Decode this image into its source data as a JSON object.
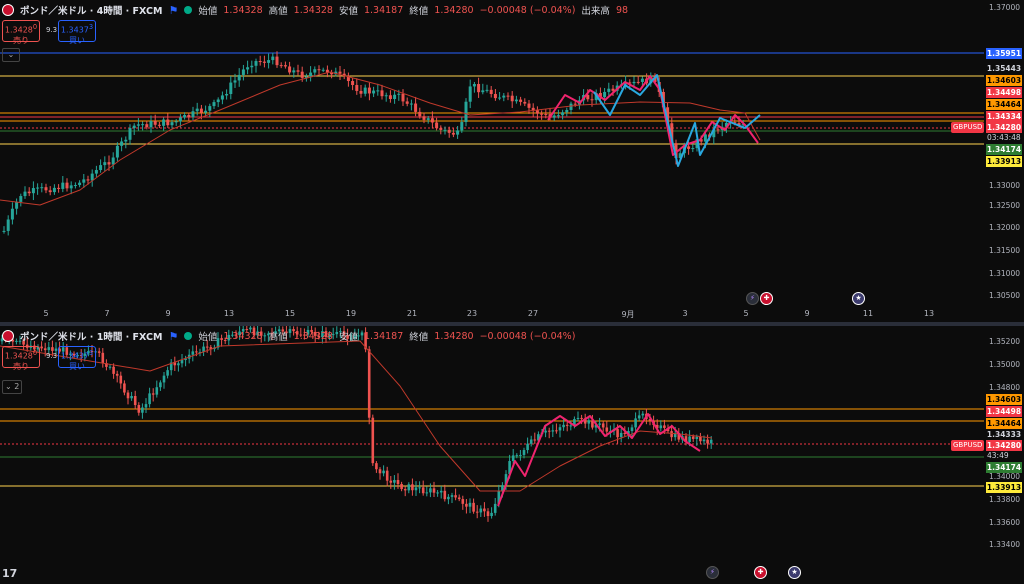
{
  "colors": {
    "up": "#26a69a",
    "down": "#ef5350",
    "ma": "#c0392b",
    "zigzag_pink": "#f0246e",
    "zigzag_blue": "#29a8e0",
    "blue_line": "#2962ff",
    "yellow_line": "#ffd54f",
    "orange_line": "#ff9800",
    "red_line": "#f23645",
    "green_line": "#2e7d32"
  },
  "pane1": {
    "legend": {
      "symbol": "ポンド／米ドル · 4時間 · FXCM",
      "open_label": "始値",
      "open": "1.34328",
      "high_label": "高値",
      "high": "1.34328",
      "low_label": "安値",
      "low": "1.34187",
      "close_label": "終値",
      "close": "1.34280",
      "change": "−0.00048 (−0.04%)",
      "volume_label": "出来高",
      "volume": "98"
    },
    "sell": {
      "price": "1.3428",
      "sup": "0",
      "label": "売り"
    },
    "spread": "9.3",
    "buy": {
      "price": "1.3437",
      "sup": "3",
      "label": "買い"
    },
    "collapse": "⌄",
    "y_ticks": [
      "1.37000",
      "1.33000",
      "1.32500",
      "1.32000",
      "1.31500",
      "1.31000",
      "1.30500"
    ],
    "price_labels": [
      {
        "text": "1.35951",
        "color": "blue"
      },
      {
        "text": "1.35443",
        "color": "none"
      },
      {
        "text": "1.34603",
        "color": "orange"
      },
      {
        "text": "1.34498",
        "color": "red"
      },
      {
        "text": "1.34464",
        "color": "orange"
      },
      {
        "text": "1.34334",
        "color": "red"
      },
      {
        "text": "1.34280",
        "color": "red"
      },
      {
        "text": "1.34174",
        "color": "green"
      },
      {
        "text": "1.33913",
        "color": "yellow"
      }
    ],
    "symbol_tag": "GBPUSD",
    "countdown": "03:43:48",
    "x_ticks": [
      "5",
      "7",
      "9",
      "13",
      "15",
      "19",
      "21",
      "23",
      "27",
      "9月",
      "3",
      "5",
      "9",
      "11",
      "13"
    ]
  },
  "pane2": {
    "legend": {
      "symbol": "ポンド／米ドル · 1時間 · FXCM",
      "open_label": "始値",
      "open": "1.34328",
      "high_label": "高値",
      "high": "1.34328",
      "low_label": "安値",
      "low": "1.34187",
      "close_label": "終値",
      "close": "1.34280",
      "change": "−0.00048 (−0.04%)"
    },
    "sell": {
      "price": "1.3428",
      "sup": "0",
      "label": "売り"
    },
    "spread": "9.3",
    "buy": {
      "price": "1.3437",
      "sup": "3",
      "label": "買い"
    },
    "collapse": "⌄ 2",
    "y_ticks": [
      "1.35200",
      "1.35000",
      "1.34800",
      "1.34000",
      "1.33800",
      "1.33600",
      "1.33400"
    ],
    "price_labels": [
      {
        "text": "1.34603",
        "color": "orange"
      },
      {
        "text": "1.34498",
        "color": "red"
      },
      {
        "text": "1.34464",
        "color": "orange"
      },
      {
        "text": "1.34333",
        "color": "none"
      },
      {
        "text": "1.34280",
        "color": "red"
      },
      {
        "text": "1.34174",
        "color": "green"
      },
      {
        "text": "1.33913",
        "color": "yellow"
      }
    ],
    "symbol_tag": "GBPUSD",
    "countdown": "43:49",
    "logo": "17"
  }
}
